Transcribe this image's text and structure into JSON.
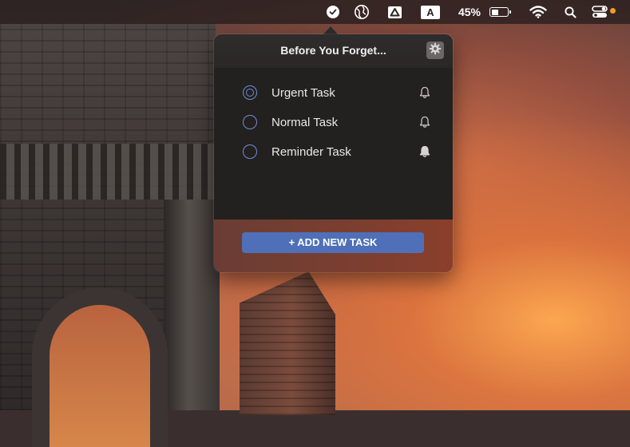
{
  "menubar": {
    "battery_percent": "45%",
    "battery_level": 0.45,
    "letter_indicator": "A",
    "notification_dot_color": "#f29a2e"
  },
  "popover": {
    "title": "Before You Forget...",
    "settings_icon": "gear-icon",
    "tasks": [
      {
        "label": "Urgent Task",
        "radio": "filled-ring",
        "bell": "outline"
      },
      {
        "label": "Normal Task",
        "radio": "empty",
        "bell": "outline"
      },
      {
        "label": "Reminder Task",
        "radio": "empty",
        "bell": "filled"
      }
    ],
    "add_button_label": "+ ADD NEW TASK",
    "accent_color": "#4f70b8",
    "radio_color": "#6f8fd4"
  }
}
